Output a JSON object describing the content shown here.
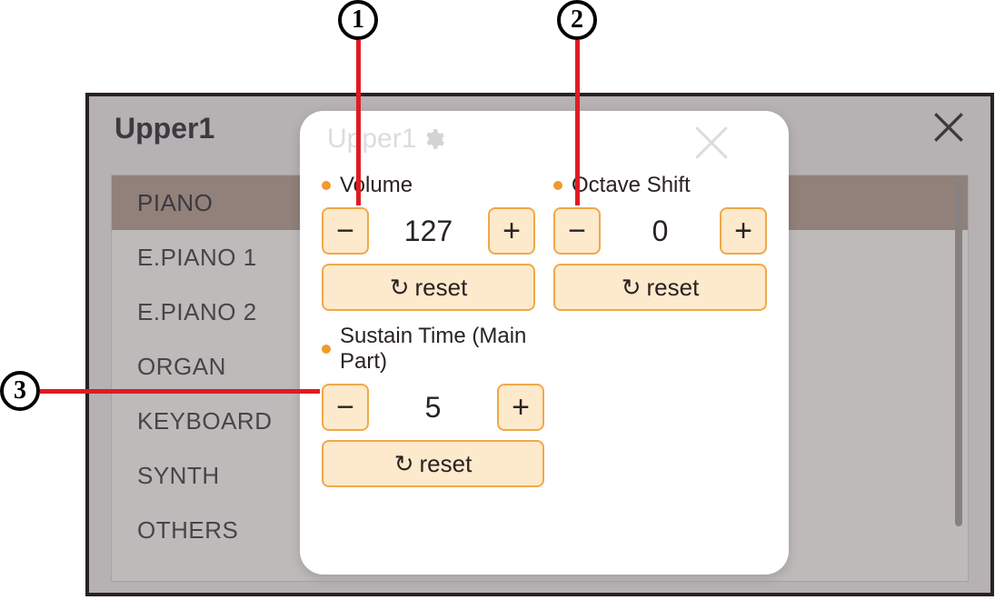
{
  "bg": {
    "title": "Upper1",
    "categories": [
      "PIANO",
      "E.PIANO 1",
      "E.PIANO 2",
      "ORGAN",
      "KEYBOARD",
      "SYNTH",
      "OTHERS"
    ],
    "selectedIndex": 0
  },
  "panel": {
    "title": "Upper1",
    "reset_label": "reset",
    "fields": {
      "volume": {
        "label": "Volume",
        "value": "127"
      },
      "octave": {
        "label": "Octave Shift",
        "value": "0"
      },
      "sustain": {
        "label": "Sustain Time (Main Part)",
        "value": "5"
      }
    }
  },
  "callouts": {
    "c1": "1",
    "c2": "2",
    "c3": "3"
  }
}
